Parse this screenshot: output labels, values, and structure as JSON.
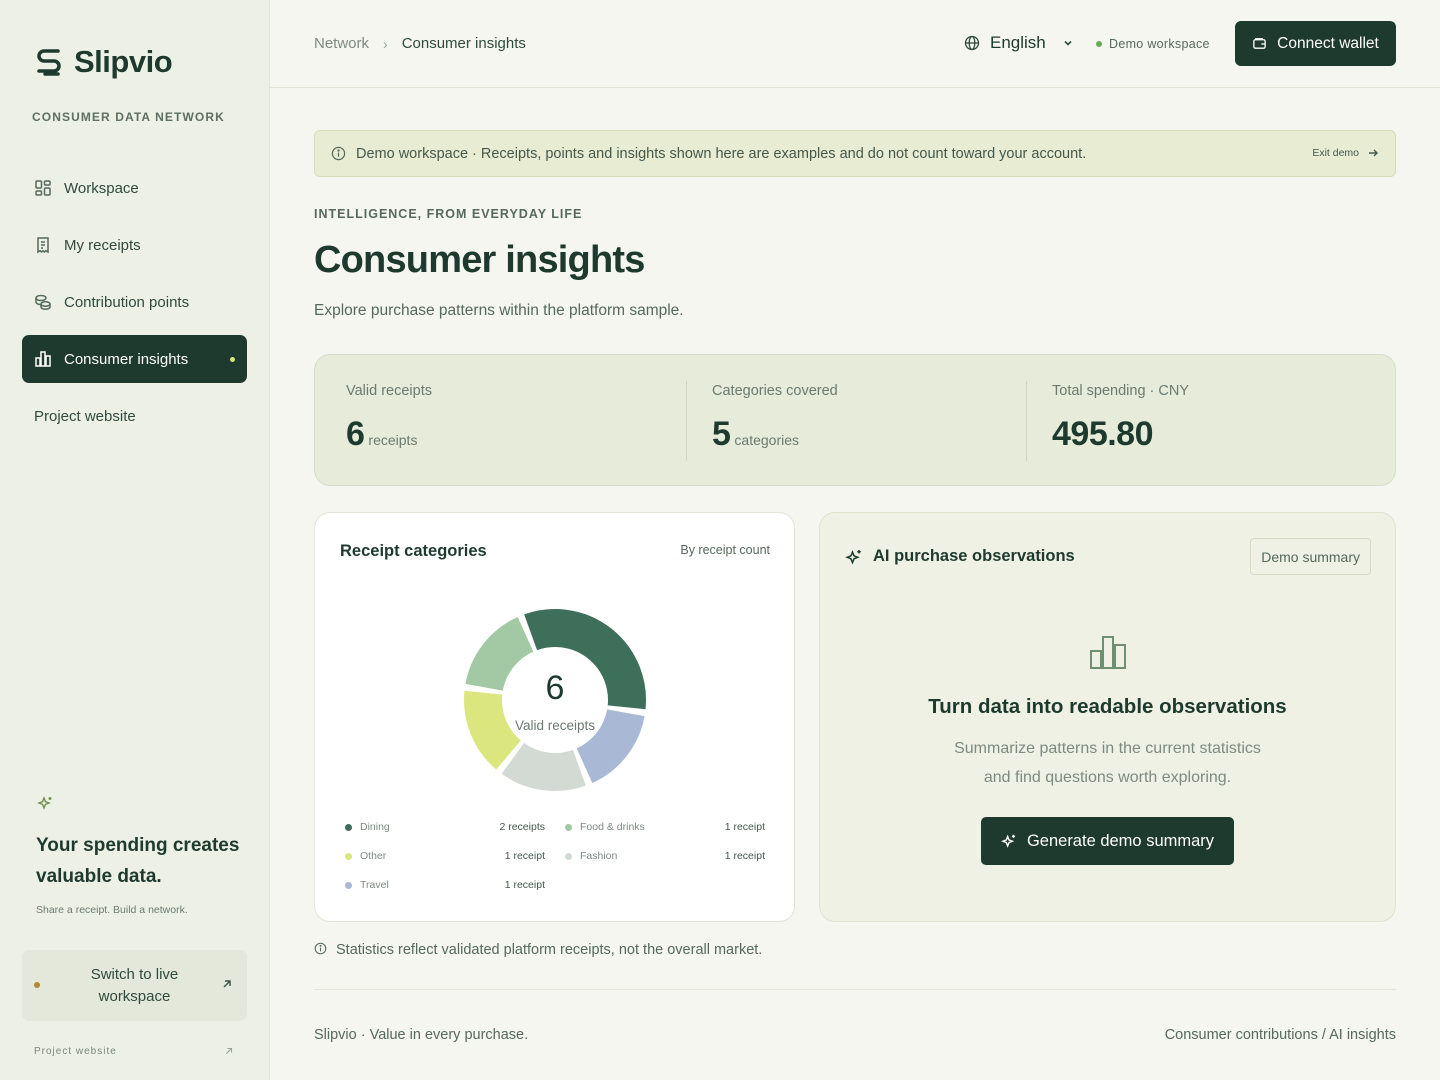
{
  "brand": {
    "name": "Slipvio",
    "tagline": "CONSUMER DATA NETWORK"
  },
  "sidebar": {
    "items": [
      {
        "label": "Workspace",
        "icon": "grid-icon"
      },
      {
        "label": "My receipts",
        "icon": "receipt-icon"
      },
      {
        "label": "Contribution points",
        "icon": "coins-icon"
      },
      {
        "label": "Consumer insights",
        "icon": "bar-chart-icon",
        "active": true
      },
      {
        "label": "Project website"
      }
    ],
    "promo": {
      "title": "Your spending creates valuable data.",
      "subtitle": "Share a receipt. Build a network."
    },
    "switch_label": "Switch to live workspace",
    "footer_link": "Project website"
  },
  "header": {
    "breadcrumb": [
      "Network",
      "Consumer insights"
    ],
    "language": "English",
    "workspace_tag": "Demo workspace",
    "connect_label": "Connect wallet"
  },
  "banner": {
    "text": "Demo workspace · Receipts, points and insights shown here are examples and do not count toward your account.",
    "exit_label": "Exit demo"
  },
  "page": {
    "kicker": "INTELLIGENCE, FROM EVERYDAY LIFE",
    "title": "Consumer insights",
    "subtitle": "Explore purchase patterns within the platform sample."
  },
  "stats": [
    {
      "label": "Valid receipts",
      "value": "6",
      "unit": "receipts"
    },
    {
      "label": "Categories covered",
      "value": "5",
      "unit": "categories"
    },
    {
      "label": "Total spending · CNY",
      "value": "495.80",
      "unit": ""
    }
  ],
  "categories_card": {
    "title": "Receipt categories",
    "mode": "By receipt count",
    "center_value": "6",
    "center_label": "Valid receipts",
    "legend": [
      {
        "name": "Dining",
        "count": "2 receipts",
        "value": 2,
        "color": "#3d6f5a"
      },
      {
        "name": "Food & drinks",
        "count": "1 receipt",
        "value": 1,
        "color": "#a3c8a4"
      },
      {
        "name": "Other",
        "count": "1 receipt",
        "value": 1,
        "color": "#dbe77e"
      },
      {
        "name": "Fashion",
        "count": "1 receipt",
        "value": 1,
        "color": "#d3d9d3"
      },
      {
        "name": "Travel",
        "count": "1 receipt",
        "value": 1,
        "color": "#a9b8d4"
      }
    ]
  },
  "ai_card": {
    "title": "AI purchase observations",
    "badge": "Demo summary",
    "heading": "Turn data into readable observations",
    "description_1": "Summarize patterns in the current statistics",
    "description_2": "and find questions worth exploring.",
    "button_label": "Generate demo summary"
  },
  "note": "Statistics reflect validated platform receipts, not the overall market.",
  "footer": {
    "left": "Slipvio · Value in every purchase.",
    "right": "Consumer contributions / AI insights"
  }
}
